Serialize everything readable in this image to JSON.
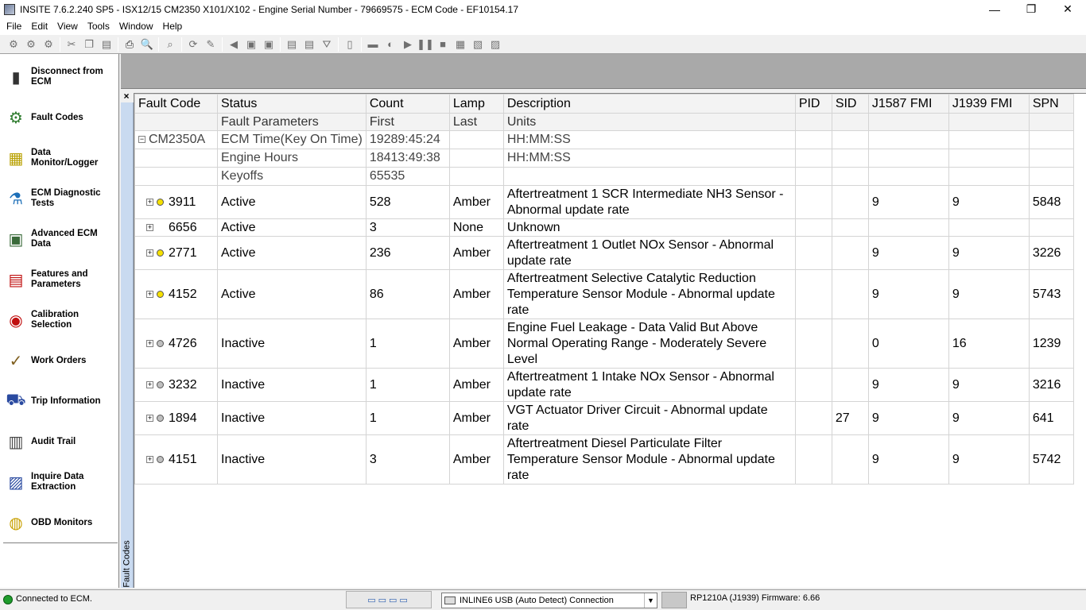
{
  "window": {
    "title": "INSITE 7.6.2.240 SP5 - ISX12/15 CM2350 X101/X102 - Engine Serial Number - 79669575 - ECM Code - EF10154.17",
    "minimize": "—",
    "restore": "❐",
    "close": "✕"
  },
  "menu": [
    "File",
    "Edit",
    "View",
    "Tools",
    "Window",
    "Help"
  ],
  "nav": [
    {
      "label": "Disconnect from ECM",
      "icon": "disconnect-icon"
    },
    {
      "label": "Fault Codes",
      "icon": "fault-codes-icon"
    },
    {
      "label": "Data Monitor/Logger",
      "icon": "data-monitor-icon"
    },
    {
      "label": "ECM Diagnostic Tests",
      "icon": "diagnostic-tests-icon"
    },
    {
      "label": "Advanced ECM Data",
      "icon": "advanced-ecm-icon"
    },
    {
      "label": "Features and Parameters",
      "icon": "features-icon"
    },
    {
      "label": "Calibration Selection",
      "icon": "calibration-icon"
    },
    {
      "label": "Work Orders",
      "icon": "work-orders-icon"
    },
    {
      "label": "Trip Information",
      "icon": "trip-info-icon"
    },
    {
      "label": "Audit Trail",
      "icon": "audit-trail-icon"
    },
    {
      "label": "Inquire Data Extraction",
      "icon": "inquire-data-icon"
    },
    {
      "label": "OBD Monitors",
      "icon": "obd-monitors-icon"
    }
  ],
  "panel": {
    "close": "×",
    "side_tab": "Fault Codes"
  },
  "grid": {
    "headers": [
      "Fault Code",
      "Status",
      "Count",
      "Lamp",
      "Description",
      "PID",
      "SID",
      "J1587 FMI",
      "J1939 FMI",
      "SPN"
    ],
    "subheaders": [
      "",
      "Fault Parameters",
      "First",
      "Last",
      "Units",
      "",
      "",
      "",
      "",
      ""
    ],
    "ecm": {
      "name": "CM2350A",
      "expander": "−",
      "params": [
        {
          "name": "ECM Time(Key On Time)",
          "first": "19289:45:24",
          "last": "",
          "units": "HH:MM:SS"
        },
        {
          "name": "Engine Hours",
          "first": "18413:49:38",
          "last": "",
          "units": "HH:MM:SS"
        },
        {
          "name": "Keyoffs",
          "first": "65535",
          "last": "",
          "units": ""
        }
      ]
    },
    "faults": [
      {
        "code": "3911",
        "lamp_state": "active",
        "status": "Active",
        "count": "528",
        "lamp": "Amber",
        "description": "Aftertreatment 1 SCR Intermediate NH3 Sensor - Abnormal update rate",
        "pid": "",
        "sid": "",
        "j1587": "9",
        "j1939": "9",
        "spn": "5848"
      },
      {
        "code": "6656",
        "lamp_state": "none",
        "status": "Active",
        "count": "3",
        "lamp": "None",
        "description": "Unknown",
        "pid": "",
        "sid": "",
        "j1587": "",
        "j1939": "",
        "spn": ""
      },
      {
        "code": "2771",
        "lamp_state": "active",
        "status": "Active",
        "count": "236",
        "lamp": "Amber",
        "description": "Aftertreatment 1 Outlet NOx Sensor - Abnormal update rate",
        "pid": "",
        "sid": "",
        "j1587": "9",
        "j1939": "9",
        "spn": "3226"
      },
      {
        "code": "4152",
        "lamp_state": "active",
        "status": "Active",
        "count": "86",
        "lamp": "Amber",
        "description": "Aftertreatment Selective Catalytic Reduction Temperature Sensor Module - Abnormal update rate",
        "pid": "",
        "sid": "",
        "j1587": "9",
        "j1939": "9",
        "spn": "5743"
      },
      {
        "code": "4726",
        "lamp_state": "inactive",
        "status": "Inactive",
        "count": "1",
        "lamp": "Amber",
        "description": "Engine Fuel Leakage - Data Valid But Above Normal Operating Range - Moderately Severe Level",
        "pid": "",
        "sid": "",
        "j1587": "0",
        "j1939": "16",
        "spn": "1239"
      },
      {
        "code": "3232",
        "lamp_state": "inactive",
        "status": "Inactive",
        "count": "1",
        "lamp": "Amber",
        "description": "Aftertreatment 1 Intake NOx Sensor - Abnormal update rate",
        "pid": "",
        "sid": "",
        "j1587": "9",
        "j1939": "9",
        "spn": "3216"
      },
      {
        "code": "1894",
        "lamp_state": "inactive",
        "status": "Inactive",
        "count": "1",
        "lamp": "Amber",
        "description": "VGT Actuator Driver Circuit - Abnormal update rate",
        "pid": "",
        "sid": "27",
        "j1587": "9",
        "j1939": "9",
        "spn": "641"
      },
      {
        "code": "4151",
        "lamp_state": "inactive",
        "status": "Inactive",
        "count": "3",
        "lamp": "Amber",
        "description": "Aftertreatment Diesel Particulate Filter Temperature Sensor Module - Abnormal update rate",
        "pid": "",
        "sid": "",
        "j1587": "9",
        "j1939": "9",
        "spn": "5742"
      }
    ]
  },
  "status": {
    "connection": "Connected to ECM.",
    "adapter": "INLINE6 USB (Auto Detect) Connection",
    "firmware": "RP1210A (J1939)  Firmware: 6.66",
    "link_indicator": "▭▭▭▭"
  },
  "colors": {
    "active_lamp": "#f5e000",
    "inactive_lamp": "#bfbfbf",
    "connected_led": "#1e9c2c"
  }
}
